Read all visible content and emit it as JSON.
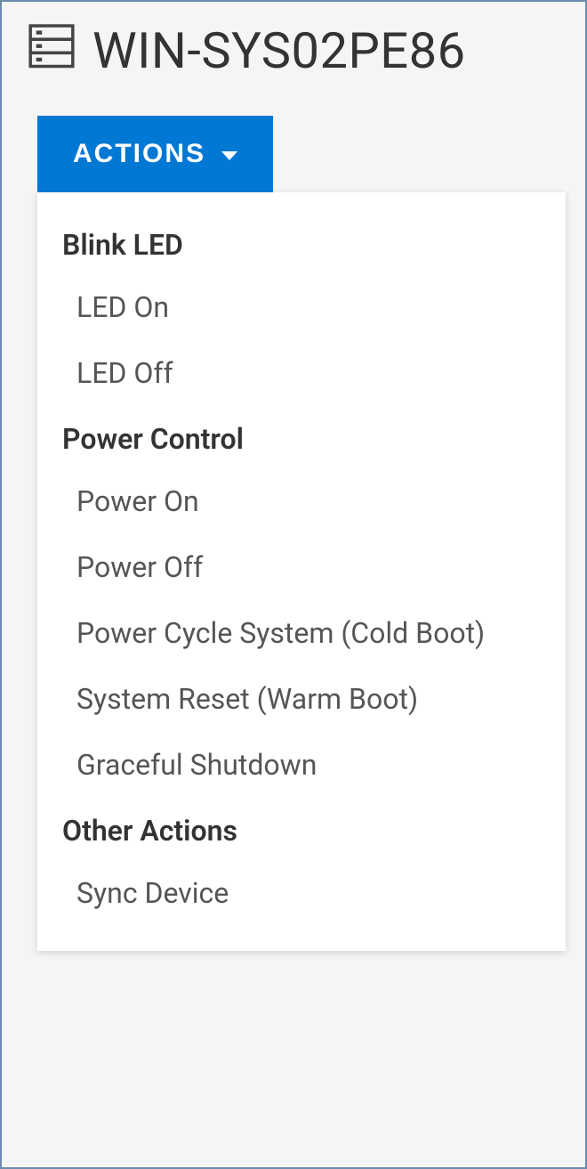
{
  "header": {
    "title": "WIN-SYS02PE86"
  },
  "actions_button": {
    "label": "ACTIONS"
  },
  "dropdown": {
    "sections": [
      {
        "header": "Blink LED",
        "items": [
          "LED On",
          "LED Off"
        ]
      },
      {
        "header": "Power Control",
        "items": [
          "Power On",
          "Power Off",
          "Power Cycle System (Cold Boot)",
          "System Reset (Warm Boot)",
          "Graceful Shutdown"
        ]
      },
      {
        "header": "Other Actions",
        "items": [
          "Sync Device"
        ]
      }
    ]
  }
}
